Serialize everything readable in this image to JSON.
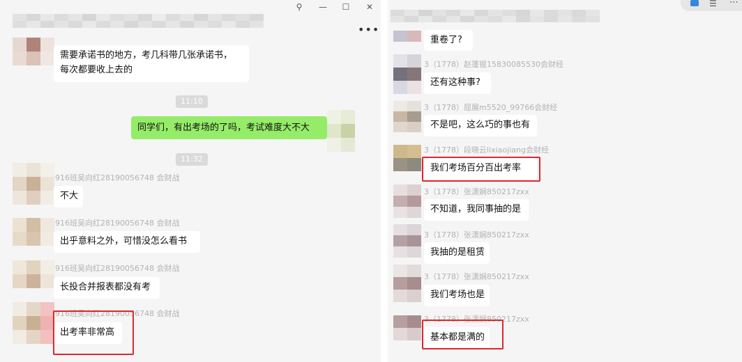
{
  "left_window": {
    "controls": {
      "pin": "⚲",
      "minimize": "—",
      "maximize": "☐",
      "close": "✕"
    },
    "more_menu": "•••",
    "messages": [
      {
        "type": "text",
        "lines": [
          "需要承诺书的地方，考几科带几张承诺书，",
          "每次都要收上去的"
        ]
      },
      {
        "type": "time",
        "text": "11:10"
      },
      {
        "type": "self",
        "text": "同学们，有出考场的了吗，考试难度大不大"
      },
      {
        "type": "time",
        "text": "11:32"
      },
      {
        "sender": "916班吴向红28190056748 会财战",
        "text": "不大"
      },
      {
        "sender": "916班吴向红28190056748 会财战",
        "text": "出乎意料之外，可惜没怎么看书"
      },
      {
        "sender": "916班吴向红28190056748 会财战",
        "text": "长投合并报表都没有考"
      },
      {
        "sender": "916班吴向红28190056748 会财战",
        "text": "出考率非常高",
        "highlighted": true
      }
    ]
  },
  "right_window": {
    "messages": [
      {
        "text": "重卷了?"
      },
      {
        "sender": "3（1778）赵蓬锟15830085530会财经",
        "text": "还有这种事?"
      },
      {
        "sender": "3（1778）屈展m5520_99766会财经",
        "text": "不是吧，这么巧的事也有"
      },
      {
        "sender": "3（1778）段晓云lixiaojiang会财经",
        "text": "我们考场百分百出考率",
        "highlighted": true
      },
      {
        "sender": "3（1778）张潇娴850217zxx",
        "text": "不知道，我同事抽的是"
      },
      {
        "sender": "3（1778）张潇娴850217zxx",
        "text": "我抽的是租赁"
      },
      {
        "sender": "3（1778）张潇娴850217zxx",
        "text": "我们考场也是"
      },
      {
        "sender": "3（1778）张潇娴850217zxx",
        "text": "基本都是满的",
        "highlighted": true
      }
    ]
  },
  "colors": {
    "self_bubble": "#95ec69",
    "highlight_box": "#e0262e",
    "chat_bg": "#f5f5f5"
  }
}
